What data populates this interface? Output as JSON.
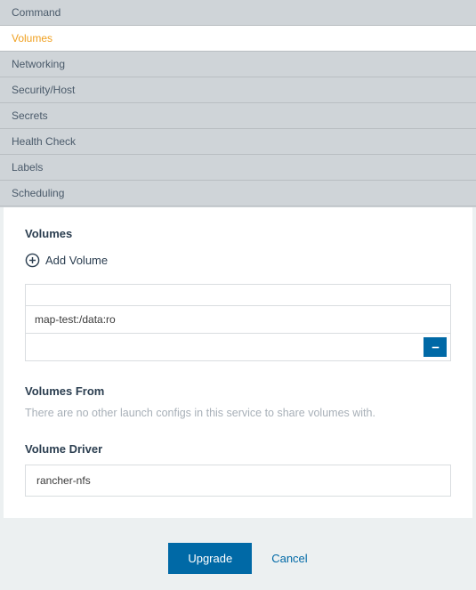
{
  "tabs": [
    {
      "label": "Command",
      "active": false
    },
    {
      "label": "Volumes",
      "active": true
    },
    {
      "label": "Networking",
      "active": false
    },
    {
      "label": "Security/Host",
      "active": false
    },
    {
      "label": "Secrets",
      "active": false
    },
    {
      "label": "Health Check",
      "active": false
    },
    {
      "label": "Labels",
      "active": false
    },
    {
      "label": "Scheduling",
      "active": false
    }
  ],
  "sections": {
    "volumes": {
      "title": "Volumes",
      "add_label": "Add Volume",
      "entries": [
        {
          "value": "map-test:/data:ro"
        }
      ]
    },
    "volumes_from": {
      "title": "Volumes From",
      "message": "There are no other launch configs in this service to share volumes with."
    },
    "volume_driver": {
      "title": "Volume Driver",
      "value": "rancher-nfs"
    }
  },
  "footer": {
    "primary": "Upgrade",
    "secondary": "Cancel"
  }
}
